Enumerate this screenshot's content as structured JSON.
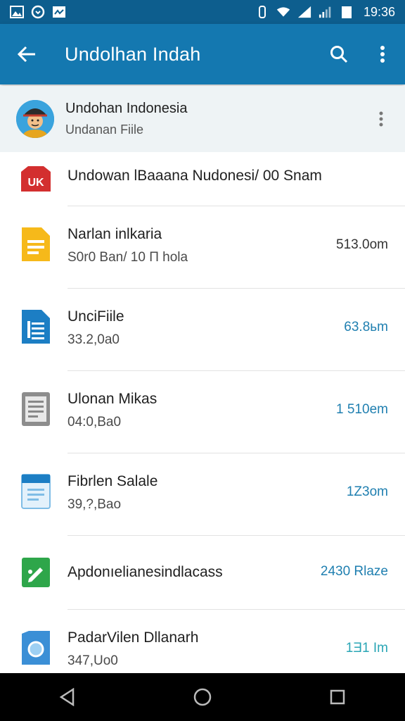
{
  "status_bar": {
    "time": "19:36",
    "left_icons": [
      "image-icon",
      "sync-icon",
      "photo-icon"
    ],
    "right_icons": [
      "vibrate-icon",
      "wifi-icon",
      "signal-icon",
      "signal-icon",
      "battery-icon"
    ]
  },
  "app_bar": {
    "title": "Undolhan Indah",
    "color": "#1478b0",
    "status_color": "#0d5e8e",
    "icons": [
      "back-arrow-icon",
      "search-icon",
      "more-vert-icon"
    ]
  },
  "account": {
    "name": "Undohan Indonesia",
    "subtitle": "Undanan Fiile",
    "background": "#eef3f5"
  },
  "list": {
    "items": [
      {
        "icon": "red-app-icon",
        "title": "Undowan lBaaana Nudonesi/ 00 Snam",
        "subtitle": "",
        "size": "",
        "size_color": "#333333"
      },
      {
        "icon": "yellow-doc-icon",
        "title": "Narlan inlkaria",
        "subtitle": "S0r0 Ban/ 10 П hola",
        "size": "513.0om",
        "size_color": "#333333"
      },
      {
        "icon": "blue-doc-icon",
        "title": "UnciFiile",
        "subtitle": "33.2,0a0",
        "size": "63.8ьm",
        "size_color": "#1f7fb0"
      },
      {
        "icon": "grey-doc-icon",
        "title": "Ulonan Mikas",
        "subtitle": "04:0,Ba0",
        "size": "1 510em",
        "size_color": "#1f7fb0"
      },
      {
        "icon": "light-blue-doc-icon",
        "title": "Fibrlen Salale",
        "subtitle": "39,?,Bao",
        "size": "1Z3om",
        "size_color": "#1f7fb0"
      },
      {
        "icon": "green-edit-icon",
        "title": "Apdonıelianesindlacass",
        "subtitle": "",
        "size": "2430 Rlaze",
        "size_color": "#1f7fb0"
      },
      {
        "icon": "blue-camera-icon",
        "title": "PadarVilen Dllanarh",
        "subtitle": "347,Uo0",
        "size": "1Ǝ1 Im",
        "size_color": "#2aa6b5"
      }
    ]
  },
  "nav_bar": {
    "icons": [
      "back-triangle-icon",
      "home-circle-icon",
      "recents-square-icon"
    ]
  }
}
